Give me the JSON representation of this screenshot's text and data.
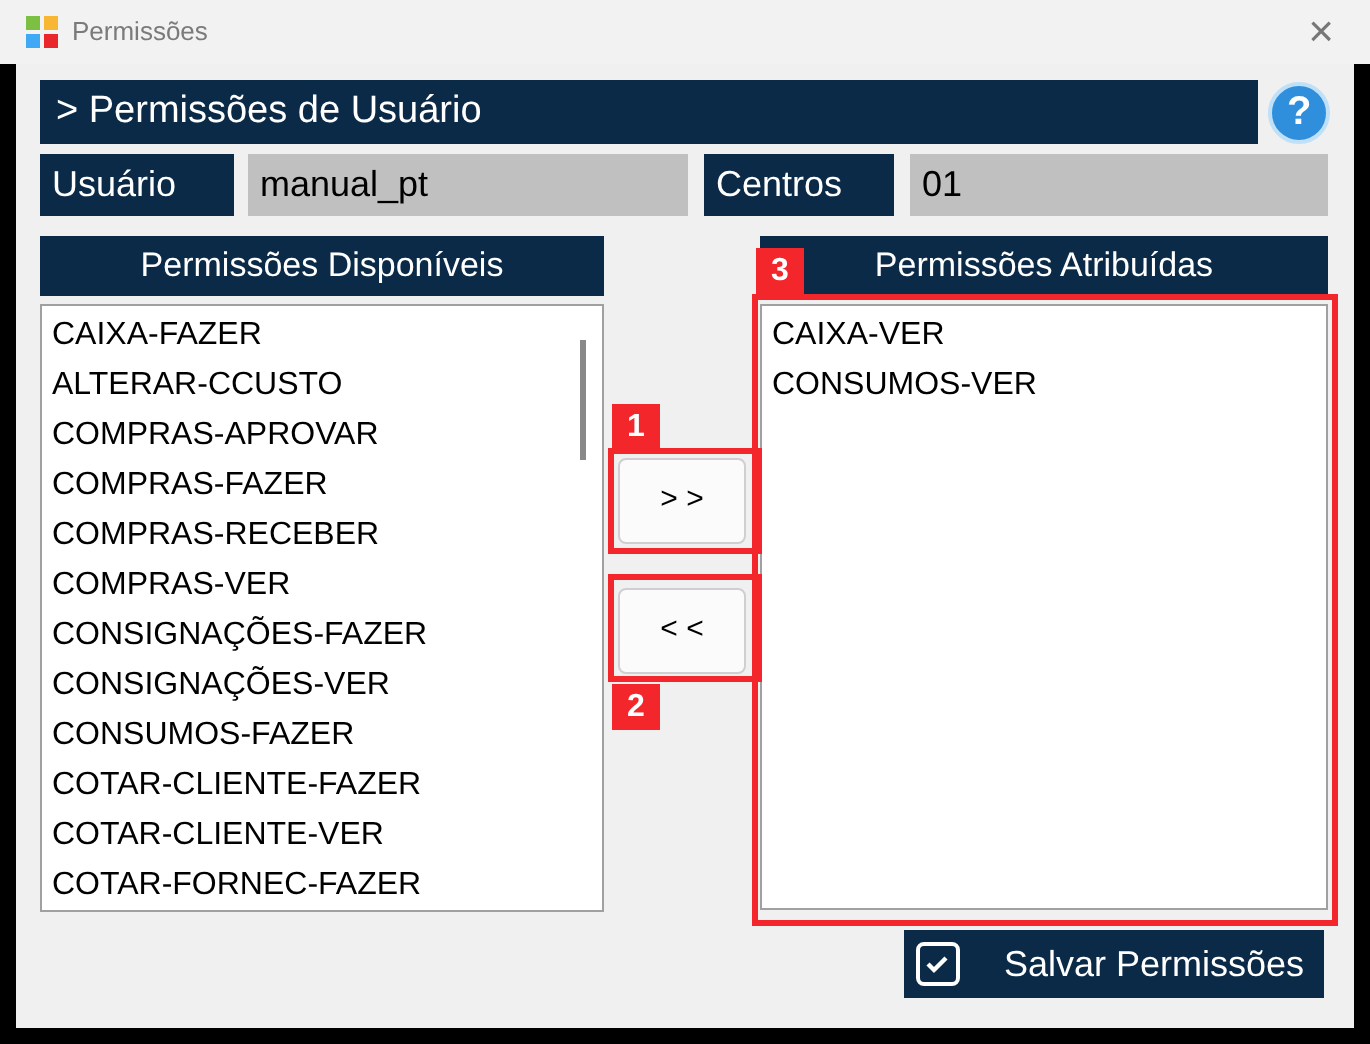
{
  "window": {
    "title": "Permissões",
    "close": "×"
  },
  "header": {
    "title": "> Permissões de Usuário",
    "help": "?"
  },
  "user": {
    "label": "Usuário",
    "value": "manual_pt"
  },
  "centers": {
    "label": "Centros",
    "value": "01"
  },
  "available": {
    "title": "Permissões Disponíveis",
    "items": [
      "CAIXA-FAZER",
      "ALTERAR-CCUSTO",
      "COMPRAS-APROVAR",
      "COMPRAS-FAZER",
      "COMPRAS-RECEBER",
      "COMPRAS-VER",
      "CONSIGNAÇÕES-FAZER",
      "CONSIGNAÇÕES-VER",
      "CONSUMOS-FAZER",
      "COTAR-CLIENTE-FAZER",
      "COTAR-CLIENTE-VER",
      "COTAR-FORNEC-FAZER"
    ]
  },
  "move_buttons": [
    {
      "label": "> >",
      "callout": "1"
    },
    {
      "label": "< <",
      "callout": "2"
    }
  ],
  "assigned": {
    "title": "Permissões Atribuídas",
    "callout": "3",
    "items": [
      "CAIXA-VER",
      "CONSUMOS-VER"
    ]
  },
  "save_button": {
    "label": "Salvar Permissões"
  }
}
